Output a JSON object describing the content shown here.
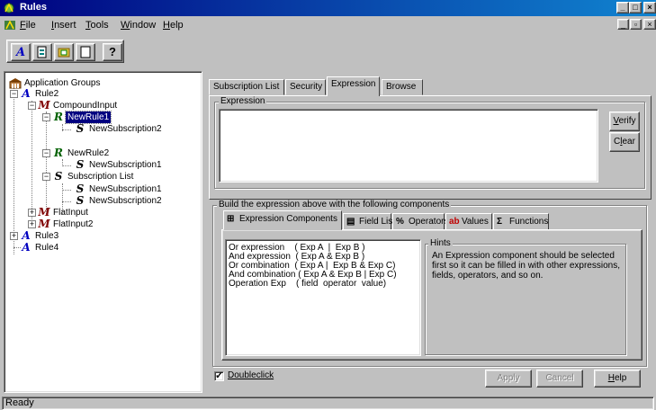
{
  "window": {
    "title": "Rules"
  },
  "menu": {
    "items": [
      {
        "label": "File",
        "mnemonic": "F",
        "rest": "ile"
      },
      {
        "label": "Insert",
        "mnemonic": "I",
        "rest": "nsert"
      },
      {
        "label": "Tools",
        "mnemonic": "T",
        "rest": "ools"
      },
      {
        "label": "Window",
        "mnemonic": "W",
        "rest": "indow"
      },
      {
        "label": "Help",
        "mnemonic": "H",
        "rest": "elp"
      }
    ]
  },
  "toolbar": {
    "buttons": [
      {
        "name": "new-rule",
        "icon": "rule-a-icon"
      },
      {
        "name": "new-doc",
        "icon": "document-icon"
      },
      {
        "name": "new-folder",
        "icon": "folder-icon"
      },
      {
        "name": "blank",
        "icon": "blank-page-icon"
      },
      {
        "name": "help",
        "icon": "help-question-icon"
      }
    ]
  },
  "tree": {
    "root": "Application Groups",
    "nodes": [
      {
        "label": "Rule2",
        "icon": "A"
      },
      {
        "label": "CompoundInput",
        "icon": "M"
      },
      {
        "label": "NewRule1",
        "icon": "R",
        "selected": true
      },
      {
        "label": "NewSubscription2",
        "icon": "S"
      },
      {
        "label": "NewRule2",
        "icon": "R"
      },
      {
        "label": "NewSubscription1",
        "icon": "S"
      },
      {
        "label": "Subscription List",
        "icon": "S"
      },
      {
        "label": "NewSubscription1",
        "icon": "S"
      },
      {
        "label": "NewSubscription2",
        "icon": "S"
      },
      {
        "label": "FlatInput",
        "icon": "M"
      },
      {
        "label": "FlatInput2",
        "icon": "M"
      },
      {
        "label": "Rule3",
        "icon": "A"
      },
      {
        "label": "Rule4",
        "icon": "A"
      }
    ]
  },
  "tabs": [
    "Subscription List",
    "Security",
    "Expression",
    "Browse"
  ],
  "active_tab": "Expression",
  "expression": {
    "group_title": "Expression",
    "value": "",
    "verify": {
      "label": "Verify",
      "mnemonic": "V",
      "rest": "erify"
    },
    "clear": {
      "label": "Clear",
      "pre": "C",
      "mnemonic": "l",
      "rest": "ear"
    }
  },
  "components": {
    "group_title": "Build the expression above with the following components",
    "tabs": [
      {
        "label": "Expression Components",
        "icon": "components-icon"
      },
      {
        "label": "Field List",
        "icon": "field-list-icon"
      },
      {
        "label": "Operators",
        "icon": "operators-icon"
      },
      {
        "label": "Values",
        "icon": "values-icon"
      },
      {
        "label": "Functions",
        "icon": "sigma-icon"
      }
    ],
    "list": [
      "Or expression    ( Exp A  |  Exp B )",
      "And expression  ( Exp A & Exp B )",
      "Or combination  ( Exp A |  Exp B & Exp C)",
      "And combination ( Exp A & Exp B | Exp C)",
      "Operation Exp    ( field  operator  value)"
    ],
    "hints_title": "Hints",
    "hints_text": "An Expression component should be selected first so it can be filled in with other expressions, fields, operators, and so on."
  },
  "footer": {
    "doubleclick": {
      "label": "Doubleclick",
      "checked": true
    },
    "apply": "Apply",
    "cancel": "Cancel",
    "help": {
      "label": "Help",
      "mnemonic": "H",
      "rest": "elp"
    }
  },
  "status": {
    "text": "Ready"
  },
  "colors": {
    "title_bar": "#000080",
    "face": "#c0c0c0",
    "selection": "#000080"
  }
}
